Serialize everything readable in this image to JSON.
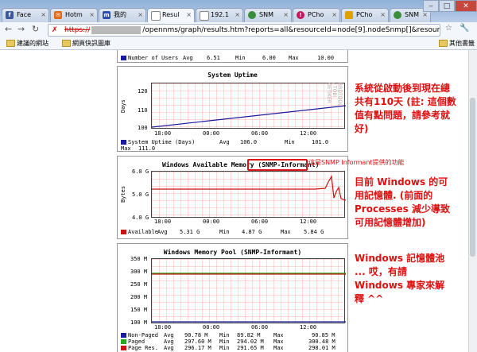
{
  "browser": {
    "tabs": [
      {
        "label": "Face",
        "icon": "facebook-icon",
        "color": "#3b5998"
      },
      {
        "label": "Hotm",
        "icon": "hotmail-icon",
        "color": "#e06a1b"
      },
      {
        "label": "我的",
        "icon": "m-logo-icon",
        "color": "#2f4fb0"
      },
      {
        "label": "Resul",
        "icon": "page-icon",
        "color": "#ffffff"
      },
      {
        "label": "192.1",
        "icon": "page-icon",
        "color": "#ffffff"
      },
      {
        "label": "SNM",
        "icon": "snmp-icon",
        "color": "#3a8d3a"
      },
      {
        "label": "PCho",
        "icon": "pchome-icon",
        "color": "#c2185b"
      },
      {
        "label": "PCho",
        "icon": "pchome-flag-icon",
        "color": "#e0a000"
      },
      {
        "label": "SNM",
        "icon": "snmp-icon",
        "color": "#3a8d3a"
      }
    ],
    "url_scheme": "https://",
    "url_rest": "/opennms/graph/results.htm?reports=all&resourceId=node[9].nodeSnmp[]&resour",
    "bookmarks": [
      "建議的網站",
      "網頁快訊圖庫"
    ],
    "other_bookmarks": "其他書籤"
  },
  "graphs": {
    "users": {
      "label": "Number of Users",
      "avg_label": "Avg",
      "avg": "6.51",
      "min_label": "Min",
      "min": "6.00",
      "max_label": "Max",
      "max": "10.00",
      "color": "#1a1aa0"
    },
    "uptime": {
      "title": "System Uptime",
      "ylabel": "Days",
      "yticks": [
        "120",
        "110",
        "100"
      ],
      "xticks": [
        "18:00",
        "00:00",
        "06:00",
        "12:00"
      ],
      "legend": "System Uptime (Days)",
      "avg_label": "Avg",
      "avg": "106.0",
      "min_label": "Min",
      "min": "101.0",
      "max_label": "Max",
      "max": "111.0",
      "color": "#1a1aa0"
    },
    "memory": {
      "title": "Windows Available Memory",
      "title_tag": "(SNMP-Informant)",
      "ylabel": "Bytes",
      "yticks": [
        "6.0 G",
        "5.0 G",
        "4.0 G"
      ],
      "xticks": [
        "18:00",
        "00:00",
        "06:00",
        "12:00"
      ],
      "legend": "Available",
      "avg_label": "Avg",
      "avg": "5.31 G",
      "min_label": "Min",
      "min": "4.87 G",
      "max_label": "Max",
      "max": "5.84 G",
      "color": "#cc1111"
    },
    "pool": {
      "title": "Windows Memory Pool (SNMP-Informant)",
      "yticks": [
        "350 M",
        "300 M",
        "250 M",
        "200 M",
        "150 M",
        "100 M"
      ],
      "xticks": [
        "18:00",
        "00:00",
        "06:00",
        "12:00"
      ],
      "series": [
        {
          "name": "Non-Paged",
          "avg": "90.78 M",
          "min": "89.82 M",
          "max": "90.85 M",
          "color": "#1a1aa0"
        },
        {
          "name": "Paged",
          "avg": "297.60 M",
          "min": "294.02 M",
          "max": "300.48 M",
          "color": "#22aa22"
        },
        {
          "name": "Page Res.",
          "avg": "296.17 M",
          "min": "291.65 M",
          "max": "298.01 M",
          "color": "#cc1111"
        }
      ],
      "avg_label": "Avg",
      "min_label": "Min",
      "max_label": "Max"
    }
  },
  "notes": {
    "uptime": "系統從啟動後到現在總共有110天 (註: 這個數值有點問題，請參考就好)",
    "informant": "這是SNMP Informant提供的功能",
    "memory": "目前 Windows 的可用記憶體. (前面的 Processes 減少導致可用記憶體增加)",
    "pool": "Windows 記憶體池 ... 哎，有請 Windows 專家來解釋 ^^"
  }
}
